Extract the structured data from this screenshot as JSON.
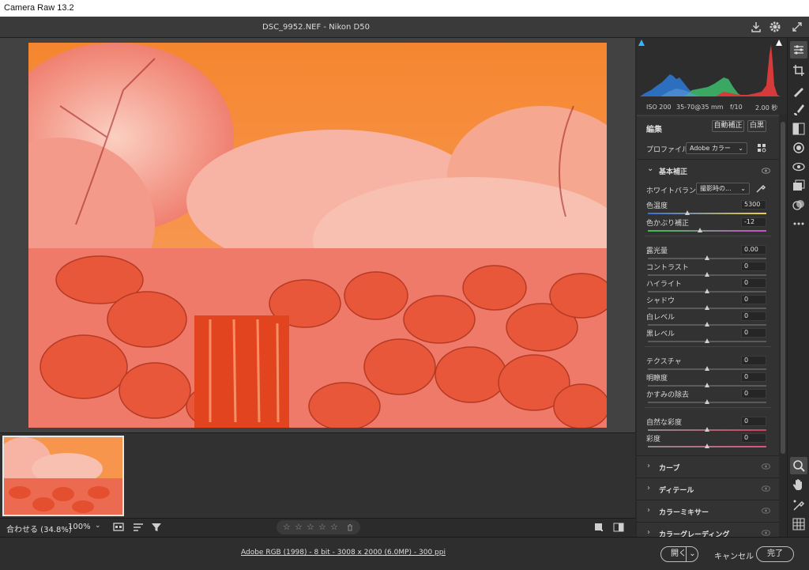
{
  "app_title": "Camera Raw 13.2",
  "header": {
    "filename": "DSC_9952.NEF  -  Nikon D50"
  },
  "exif": {
    "iso": "ISO 200",
    "lens": "35-70@35 mm",
    "aperture": "f/10",
    "shutter": "2.00 秒"
  },
  "edit": {
    "title": "編集",
    "auto_label": "自動補正",
    "bw_label": "白黒",
    "profile_label": "プロファイル",
    "profile_value": "Adobe カラー",
    "basic": {
      "title": "基本補正",
      "wb_label": "ホワイトバランス",
      "wb_value": "撮影時の...",
      "sliders": [
        {
          "label": "色温度",
          "value": "5300",
          "pos": 0.33
        },
        {
          "label": "色かぶり補正",
          "value": "-12",
          "pos": 0.44
        },
        {
          "label": "露光量",
          "value": "0.00",
          "pos": 0.5
        },
        {
          "label": "コントラスト",
          "value": "0",
          "pos": 0.5
        },
        {
          "label": "ハイライト",
          "value": "0",
          "pos": 0.5
        },
        {
          "label": "シャドウ",
          "value": "0",
          "pos": 0.5
        },
        {
          "label": "白レベル",
          "value": "0",
          "pos": 0.5
        },
        {
          "label": "黒レベル",
          "value": "0",
          "pos": 0.5
        },
        {
          "label": "テクスチャ",
          "value": "0",
          "pos": 0.5
        },
        {
          "label": "明瞭度",
          "value": "0",
          "pos": 0.5
        },
        {
          "label": "かすみの除去",
          "value": "0",
          "pos": 0.5
        },
        {
          "label": "自然な彩度",
          "value": "0",
          "pos": 0.5
        },
        {
          "label": "彩度",
          "value": "0",
          "pos": 0.5
        }
      ]
    },
    "sections": [
      {
        "label": "カーブ"
      },
      {
        "label": "ディテール"
      },
      {
        "label": "カラーミキサー"
      },
      {
        "label": "カラーグレーディング"
      }
    ]
  },
  "viewbar": {
    "zoom_fit": "合わせる (34.8%)",
    "zoom_100": "100%"
  },
  "footer": {
    "meta": "Adobe RGB (1998) - 8 bit - 3008 x 2000 (6.0MP) - 300 ppi",
    "open_label": "開く",
    "cancel_label": "キャンセル",
    "done_label": "完了"
  },
  "colors": {
    "accent": "#f0703a",
    "panel_bg": "#323232",
    "bg": "#282828"
  }
}
